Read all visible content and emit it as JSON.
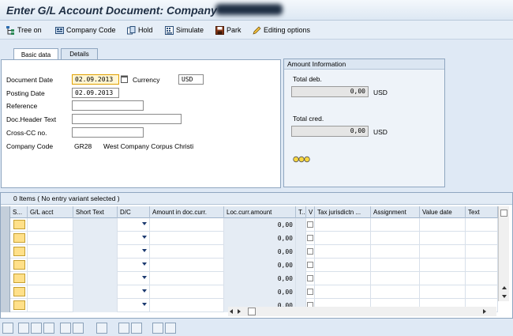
{
  "title": "Enter G/L Account Document: Company",
  "toolbar": {
    "tree_on": "Tree on",
    "company_code": "Company Code",
    "hold": "Hold",
    "simulate": "Simulate",
    "park": "Park",
    "editing_options": "Editing options"
  },
  "tabs": {
    "basic_data": "Basic data",
    "details": "Details"
  },
  "basic": {
    "document_date_label": "Document Date",
    "document_date": "02.09.2013",
    "currency_label": "Currency",
    "currency": "USD",
    "posting_date_label": "Posting Date",
    "posting_date": "02.09.2013",
    "reference_label": "Reference",
    "reference": "",
    "doc_header_label": "Doc.Header Text",
    "doc_header": "",
    "cross_cc_label": "Cross-CC no.",
    "cross_cc": "",
    "company_code_label": "Company Code",
    "company_code": "GR28",
    "company_name": "West Company Corpus Christi"
  },
  "amount_info": {
    "header": "Amount Information",
    "total_deb_label": "Total deb.",
    "total_deb": "0,00",
    "total_deb_cur": "USD",
    "total_cred_label": "Total cred.",
    "total_cred": "0,00",
    "total_cred_cur": "USD"
  },
  "grid": {
    "title": "0 Items ( No entry variant selected )",
    "columns": {
      "s": "S...",
      "gl_acct": "G/L acct",
      "short_text": "Short Text",
      "dc": "D/C",
      "amt_doc": "Amount in doc.curr.",
      "loc_amt": "Loc.curr.amount",
      "t": "T..",
      "v": "V",
      "tax": "Tax jurisdictn ...",
      "assignment": "Assignment",
      "value_date": "Value date",
      "text": "Text"
    },
    "loc_values": [
      "0,00",
      "0,00",
      "0,00",
      "0,00",
      "0,00",
      "0,00",
      "0,00"
    ]
  },
  "icons": [
    "tree-icon",
    "company-code-icon",
    "hold-icon",
    "simulate-icon",
    "park-icon",
    "editing-options-icon",
    "calendar-icon",
    "status-lights-icon"
  ]
}
